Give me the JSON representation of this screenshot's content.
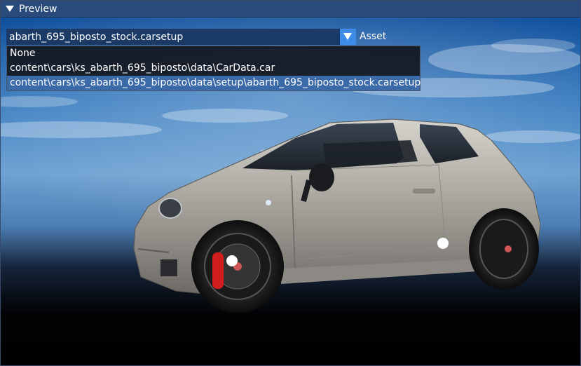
{
  "title": "Preview",
  "asset_selector": {
    "value": "abarth_695_biposto_stock.carsetup",
    "label": "Asset",
    "options": [
      "None",
      "content\\cars\\ks_abarth_695_biposto\\data\\CarData.car",
      "content\\cars\\ks_abarth_695_biposto\\data\\setup\\abarth_695_biposto_stock.carsetup"
    ],
    "selected_index": 2
  },
  "colors": {
    "titlebar": "#294a7a",
    "combo_background": "#1c3a66",
    "combo_arrow": "#3d8de8",
    "selected_option": "#3a6aa8",
    "car_body": "#b7b3ad",
    "brake_caliper": "#d01e1e"
  },
  "icons": [
    "collapse-triangle-icon",
    "dropdown-arrow-icon"
  ]
}
